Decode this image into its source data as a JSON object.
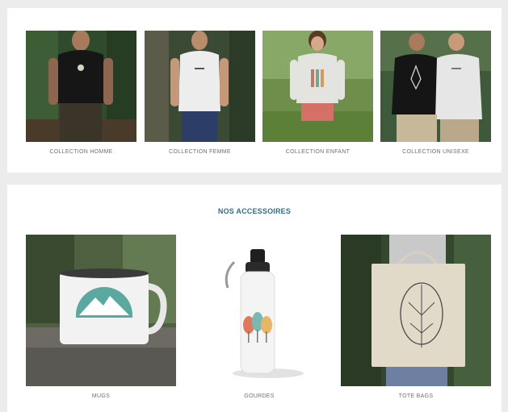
{
  "collections": [
    {
      "label": "COLLECTION HOMME"
    },
    {
      "label": "COLLECTION FEMME"
    },
    {
      "label": "COLLECTION ENFANT"
    },
    {
      "label": "COLLECTION UNISEXE"
    }
  ],
  "accessories": {
    "title": "NOS ACCESSOIRES",
    "items": [
      {
        "label": "MUGS"
      },
      {
        "label": "GOURDES"
      },
      {
        "label": "TOTE BAGS"
      }
    ]
  },
  "colors": {
    "page_bg": "#ececec",
    "panel_bg": "#ffffff",
    "title_accent": "#2f6e86",
    "caption": "#6f6f6f"
  }
}
